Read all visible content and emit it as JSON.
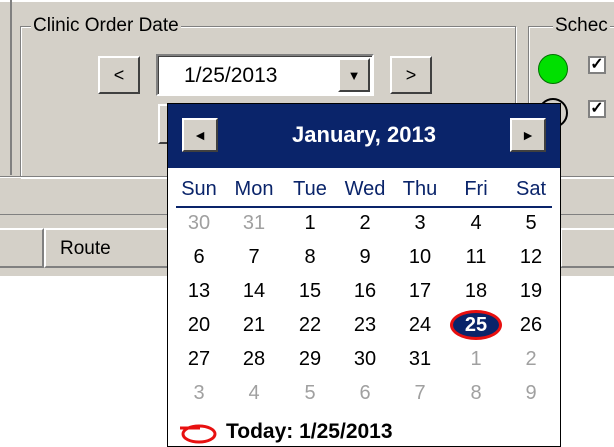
{
  "order_date": {
    "group_title": "Clinic Order Date",
    "prev_label": "<",
    "next_label": ">",
    "value": "1/25/2013",
    "dropdown_glyph": "▼"
  },
  "schedule": {
    "group_title": "Schec",
    "green_color": "#00e000",
    "check_glyph": "✓"
  },
  "grid": {
    "route_header": "Route"
  },
  "calendar": {
    "title": "January, 2013",
    "prev_glyph": "◄",
    "next_glyph": "►",
    "weekdays": [
      "Sun",
      "Mon",
      "Tue",
      "Wed",
      "Thu",
      "Fri",
      "Sat"
    ],
    "weeks": [
      [
        "30",
        "31",
        "1",
        "2",
        "3",
        "4",
        "5"
      ],
      [
        "6",
        "7",
        "8",
        "9",
        "10",
        "11",
        "12"
      ],
      [
        "13",
        "14",
        "15",
        "16",
        "17",
        "18",
        "19"
      ],
      [
        "20",
        "21",
        "22",
        "23",
        "24",
        "25",
        "26"
      ],
      [
        "27",
        "28",
        "29",
        "30",
        "31",
        "1",
        "2"
      ],
      [
        "3",
        "4",
        "5",
        "6",
        "7",
        "8",
        "9"
      ]
    ],
    "selected_day": "25",
    "today_label": "Today: 1/25/2013",
    "header_color": "#0a246a",
    "marker_color": "#e81010"
  }
}
